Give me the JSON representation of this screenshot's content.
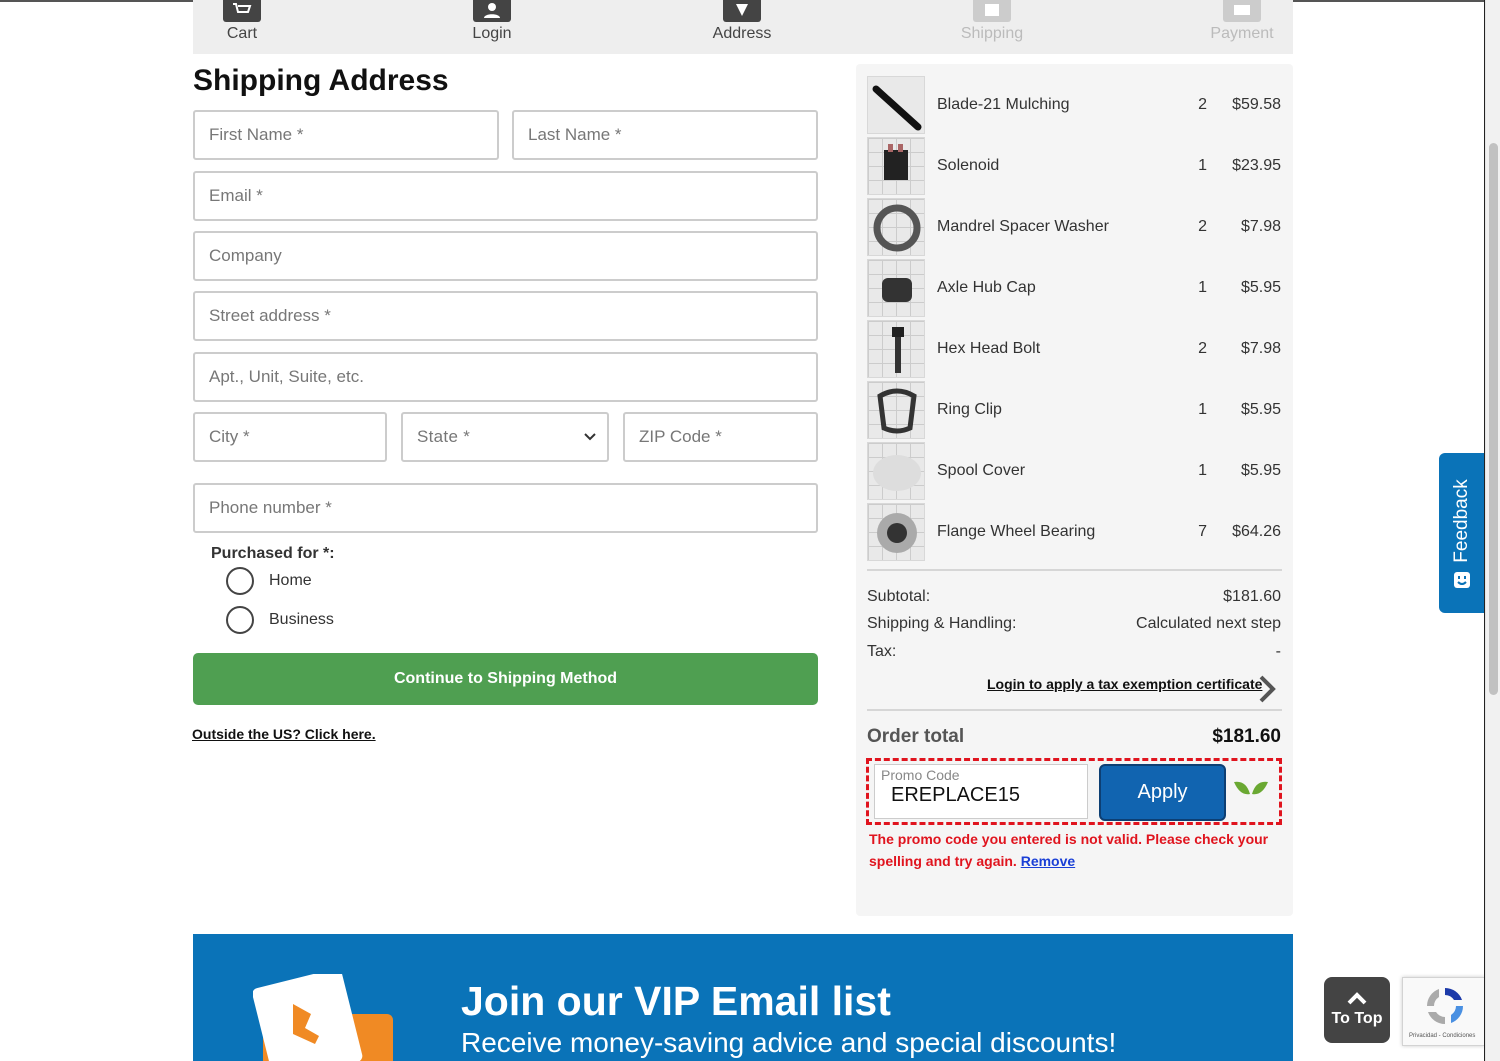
{
  "steps": [
    {
      "label": "Cart",
      "icon": "cart-icon"
    },
    {
      "label": "Login",
      "icon": "user-icon"
    },
    {
      "label": "Address",
      "icon": "map-pin-icon"
    },
    {
      "label": "Shipping",
      "icon": "box-icon"
    },
    {
      "label": "Payment",
      "icon": "card-icon"
    }
  ],
  "form": {
    "title": "Shipping Address",
    "first_name": "First Name *",
    "last_name": "Last Name *",
    "email": "Email *",
    "company": "Company",
    "street": "Street address *",
    "apt": "Apt., Unit, Suite, etc.",
    "city": "City *",
    "state": "State *",
    "zip": "ZIP Code *",
    "phone": "Phone number *",
    "purchased_for_label": "Purchased for *:",
    "purchased_options": [
      "Home",
      "Business"
    ],
    "continue_label": "Continue to Shipping Method",
    "outside_us": "Outside the US? Click here."
  },
  "order": {
    "items": [
      {
        "name": "Blade-21 Mulching",
        "qty": "2",
        "price": "$59.58"
      },
      {
        "name": "Solenoid",
        "qty": "1",
        "price": "$23.95"
      },
      {
        "name": "Mandrel Spacer Washer",
        "qty": "2",
        "price": "$7.98"
      },
      {
        "name": "Axle Hub Cap",
        "qty": "1",
        "price": "$5.95"
      },
      {
        "name": "Hex Head Bolt",
        "qty": "2",
        "price": "$7.98"
      },
      {
        "name": "Ring Clip",
        "qty": "1",
        "price": "$5.95"
      },
      {
        "name": "Spool Cover",
        "qty": "1",
        "price": "$5.95"
      },
      {
        "name": "Flange Wheel Bearing",
        "qty": "7",
        "price": "$64.26"
      }
    ],
    "subtotal_label": "Subtotal:",
    "subtotal": "$181.60",
    "shipping_label": "Shipping & Handling:",
    "shipping": "Calculated next step",
    "tax_label": "Tax:",
    "tax": "-",
    "tax_link": "Login to apply a tax exemption certificate",
    "total_label": "Order total",
    "total": "$181.60",
    "promo_label": "Promo Code",
    "promo_value": "EREPLACE15",
    "apply_label": "Apply",
    "promo_error": "The promo code you entered is not valid. Please check your spelling and try again.",
    "promo_remove": "Remove"
  },
  "vip": {
    "title": "Join our VIP Email list",
    "subtitle": "Receive money-saving advice and special discounts!"
  },
  "feedback_label": "Feedback",
  "totop_label": "To Top",
  "recaptcha_text": "Privacidad - Condiciones",
  "colors": {
    "accent": "#0a73b8",
    "continue": "#4f9f51",
    "error": "#e0141e"
  }
}
